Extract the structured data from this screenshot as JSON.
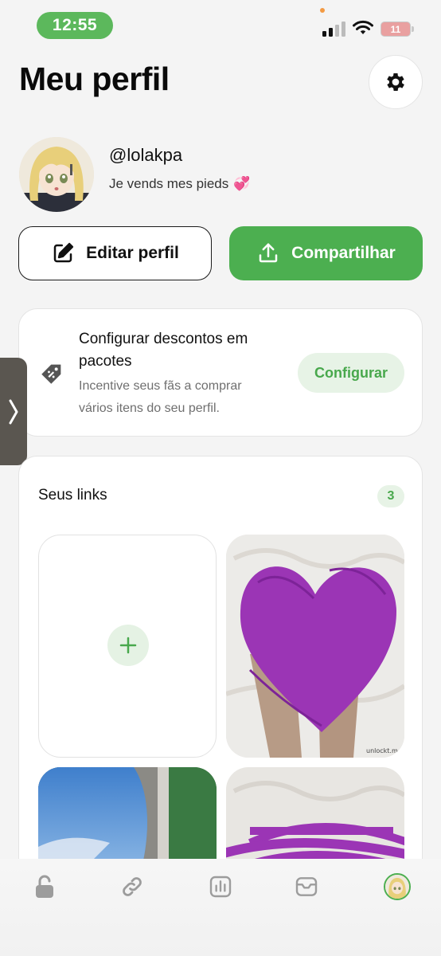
{
  "status_bar": {
    "time": "12:55",
    "battery": "11",
    "accent": "#5cb85c"
  },
  "header": {
    "title": "Meu perfil",
    "settings_icon": "gear-icon"
  },
  "profile": {
    "username": "@lolakpa",
    "bio": "Je vends mes pieds",
    "bio_emoji": "💞"
  },
  "actions": {
    "edit_label": "Editar perfil",
    "edit_icon": "edit-icon",
    "share_label": "Compartilhar",
    "share_icon": "upload-icon",
    "share_color": "#4caf50"
  },
  "discount": {
    "title": "Configurar descontos em pacotes",
    "description": "Incentive seus fãs a comprar vários itens do seu perfil.",
    "button_label": "Configurar",
    "icon": "tag-icon"
  },
  "links": {
    "title": "Seus links",
    "count": "3",
    "add_icon": "plus-icon",
    "watermark": "unlockt.m"
  },
  "tab_bar": {
    "items": [
      "lock-icon",
      "link-icon",
      "stats-icon",
      "inbox-icon",
      "profile-avatar"
    ]
  }
}
